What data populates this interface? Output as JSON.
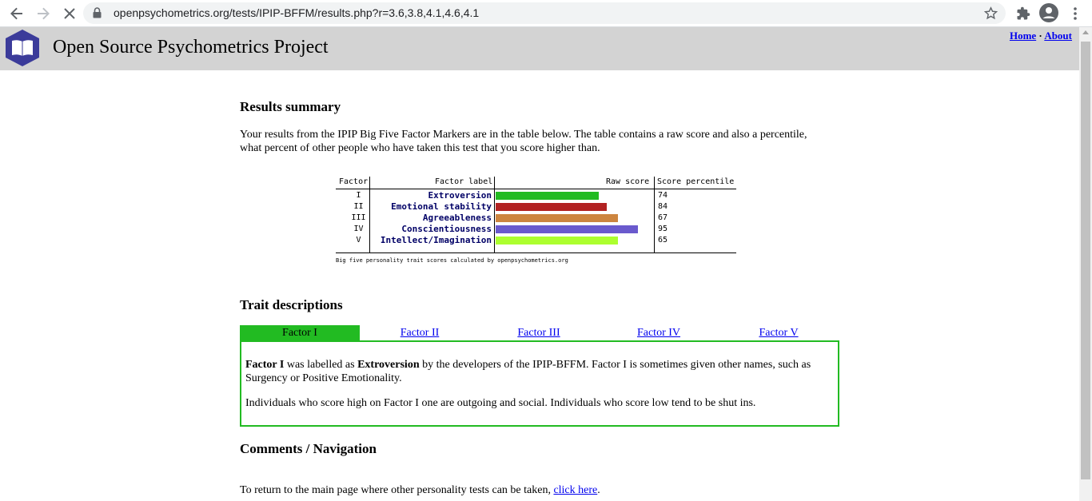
{
  "browser": {
    "url": "openpsychometrics.org/tests/IPIP-BFFM/results.php?r=3.6,3.8,4.1,4.6,4.1"
  },
  "header": {
    "title": "Open Source Psychometrics Project",
    "links": {
      "home": "Home",
      "separator": "·",
      "about": "About"
    }
  },
  "summary": {
    "heading": "Results summary",
    "intro": "Your results from the IPIP Big Five Factor Markers are in the table below. The table contains a raw score and also a percentile, what percent of other people who have taken this test that you score higher than."
  },
  "chart_data": {
    "type": "bar",
    "columns": [
      "Factor",
      "Factor label",
      "Raw score",
      "Score percentile"
    ],
    "rows": [
      {
        "factor": "I",
        "label": "Extroversion",
        "raw": 3.6,
        "percentile": "74",
        "color": "#22bb22"
      },
      {
        "factor": "II",
        "label": "Emotional stability",
        "raw": 3.8,
        "percentile": "84",
        "color": "#b22222"
      },
      {
        "factor": "III",
        "label": "Agreeableness",
        "raw": 4.1,
        "percentile": "67",
        "color": "#cd853f"
      },
      {
        "factor": "IV",
        "label": "Conscientiousness",
        "raw": 4.6,
        "percentile": "95",
        "color": "#6a5acd"
      },
      {
        "factor": "V",
        "label": "Intellect/Imagination",
        "raw": 4.1,
        "percentile": "65",
        "color": "#adff2f"
      }
    ],
    "raw_scale": [
      1,
      5
    ],
    "caption": "Big five personality trait scores calculated by openpsychometrics.org"
  },
  "traits": {
    "heading": "Trait descriptions",
    "tabs": [
      "Factor I",
      "Factor II",
      "Factor III",
      "Factor IV",
      "Factor V"
    ],
    "active_tab": 0,
    "panel": {
      "p1_b1": "Factor I",
      "p1_t1": " was labelled as ",
      "p1_b2": "Extroversion",
      "p1_t2": " by the developers of the IPIP-BFFM. Factor I is sometimes given other names, such as Surgency or Positive Emotionality.",
      "p2": "Individuals who score high on Factor I one are outgoing and social. Individuals who score low tend to be shut ins."
    }
  },
  "comments": {
    "heading": "Comments / Navigation",
    "text": "To return to the main page where other personality tests can be taken, ",
    "link": "click here",
    "end": "."
  }
}
